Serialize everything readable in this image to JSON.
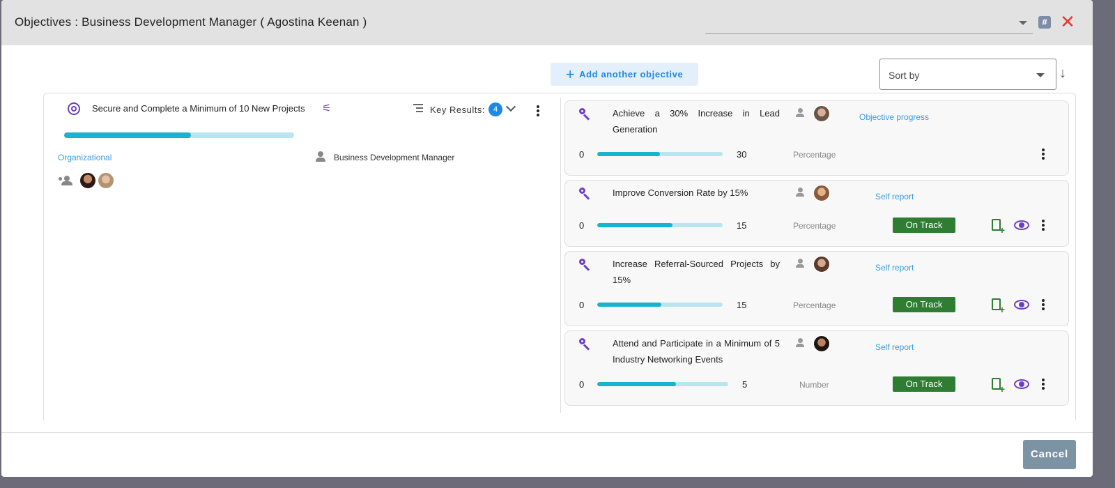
{
  "modal": {
    "title": "Objectives : Business Development Manager ( Agostina Keenan )",
    "cancel_label": "Cancel"
  },
  "toolbar": {
    "add_objective_label": "Add another objective",
    "sort_placeholder": "Sort by"
  },
  "objective": {
    "title": "Secure and Complete a Minimum of 10 New Projects",
    "key_results_label": "Key Results:",
    "key_results_count": "4",
    "progress_fraction": 0.55,
    "type_label": "Organizational",
    "owner_label": "Business Development Manager"
  },
  "key_results": [
    {
      "title": "Achieve a 30% Increase in Lead Generation",
      "link_label": "Objective progress",
      "start": "0",
      "target": "30",
      "unit": "Percentage",
      "progress_fraction": 0.5,
      "status": ""
    },
    {
      "title": "Improve Conversion Rate by 15%",
      "link_label": "Self report",
      "start": "0",
      "target": "15",
      "unit": "Percentage",
      "progress_fraction": 0.6,
      "status": "On Track"
    },
    {
      "title": "Increase Referral-Sourced Projects by 15%",
      "link_label": "Self report",
      "start": "0",
      "target": "15",
      "unit": "Percentage",
      "progress_fraction": 0.51,
      "status": "On Track"
    },
    {
      "title": "Attend and Participate in a Minimum of 5 Industry Networking Events",
      "link_label": "Self report",
      "start": "0",
      "target": "5",
      "unit": "Number",
      "progress_fraction": 0.6,
      "status": "On Track"
    }
  ],
  "colors": {
    "accent_purple": "#6c3fc4",
    "progress_fill": "#17b3cf",
    "progress_track": "#b8e6ef",
    "status_green": "#2e7d32",
    "link_blue": "#3a9be0",
    "close_red": "#e53935"
  },
  "icons": {
    "objective": "target-icon",
    "key_result": "key-icon",
    "add_report": "file-plus-icon",
    "view": "eye-icon",
    "close": "close-icon"
  }
}
